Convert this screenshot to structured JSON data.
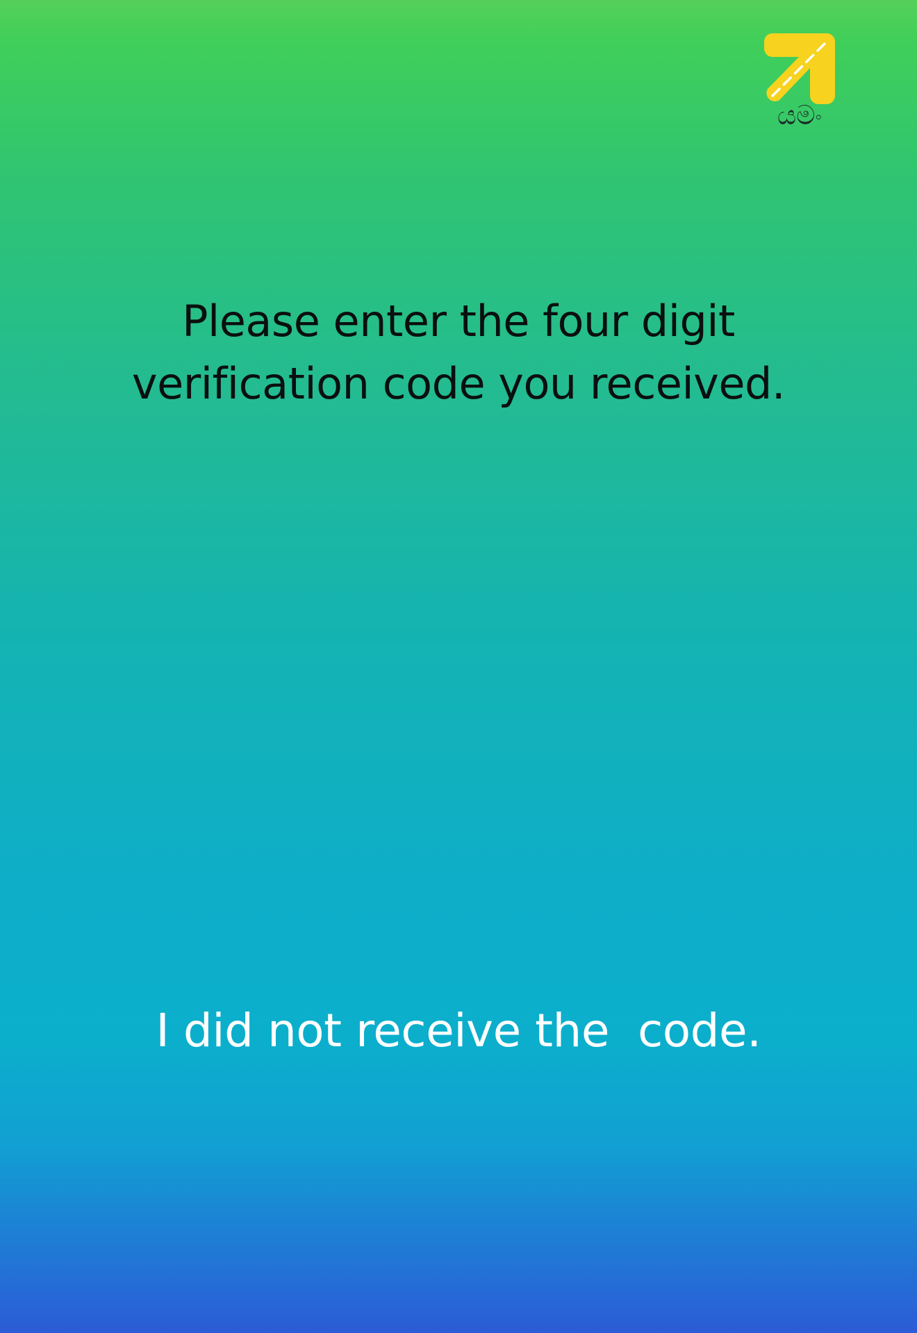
{
  "app": {
    "logo_text": "යමං",
    "brand_color": "#f7d21f"
  },
  "verification": {
    "prompt_line1": "Please enter the four digit",
    "prompt_line2": "verification code you received.",
    "resend_label": "I did not receive the  code."
  }
}
